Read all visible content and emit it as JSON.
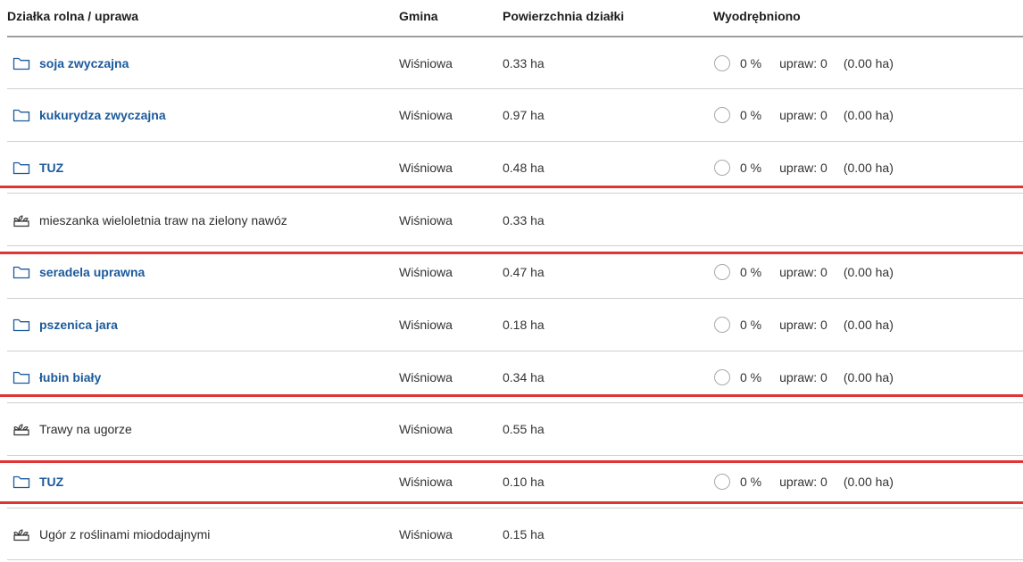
{
  "header": {
    "name": "Działka rolna / uprawa",
    "gmina": "Gmina",
    "area": "Powierzchnia działki",
    "extracted": "Wyodrębniono"
  },
  "rows": [
    {
      "type": "folder",
      "name": "soja zwyczajna",
      "gmina": "Wiśniowa",
      "area": "0.33 ha",
      "pct": "0 %",
      "upraw": "upraw: 0",
      "ha": "(0.00 ha)"
    },
    {
      "type": "folder",
      "name": "kukurydza zwyczajna",
      "gmina": "Wiśniowa",
      "area": "0.97 ha",
      "pct": "0 %",
      "upraw": "upraw: 0",
      "ha": "(0.00 ha)"
    },
    {
      "type": "folder",
      "name": "TUZ",
      "gmina": "Wiśniowa",
      "area": "0.48 ha",
      "pct": "0 %",
      "upraw": "upraw: 0",
      "ha": "(0.00 ha)"
    },
    {
      "type": "crop",
      "name": "mieszanka wieloletnia traw na zielony nawóz",
      "gmina": "Wiśniowa",
      "area": "0.33 ha"
    },
    {
      "type": "folder",
      "name": "seradela uprawna",
      "gmina": "Wiśniowa",
      "area": "0.47 ha",
      "pct": "0 %",
      "upraw": "upraw: 0",
      "ha": "(0.00 ha)"
    },
    {
      "type": "folder",
      "name": "pszenica jara",
      "gmina": "Wiśniowa",
      "area": "0.18 ha",
      "pct": "0 %",
      "upraw": "upraw: 0",
      "ha": "(0.00 ha)"
    },
    {
      "type": "folder",
      "name": "łubin biały",
      "gmina": "Wiśniowa",
      "area": "0.34 ha",
      "pct": "0 %",
      "upraw": "upraw: 0",
      "ha": "(0.00 ha)"
    },
    {
      "type": "crop",
      "name": "Trawy na ugorze",
      "gmina": "Wiśniowa",
      "area": "0.55 ha"
    },
    {
      "type": "folder",
      "name": "TUZ",
      "gmina": "Wiśniowa",
      "area": "0.10 ha",
      "pct": "0 %",
      "upraw": "upraw: 0",
      "ha": "(0.00 ha)"
    },
    {
      "type": "crop",
      "name": "Ugór z roślinami miododajnymi",
      "gmina": "Wiśniowa",
      "area": "0.15 ha"
    }
  ],
  "icons": {
    "folder": "folder-icon",
    "crop": "crop-icon"
  },
  "colors": {
    "link": "#1c5a9c",
    "highlight": "#e03535"
  }
}
